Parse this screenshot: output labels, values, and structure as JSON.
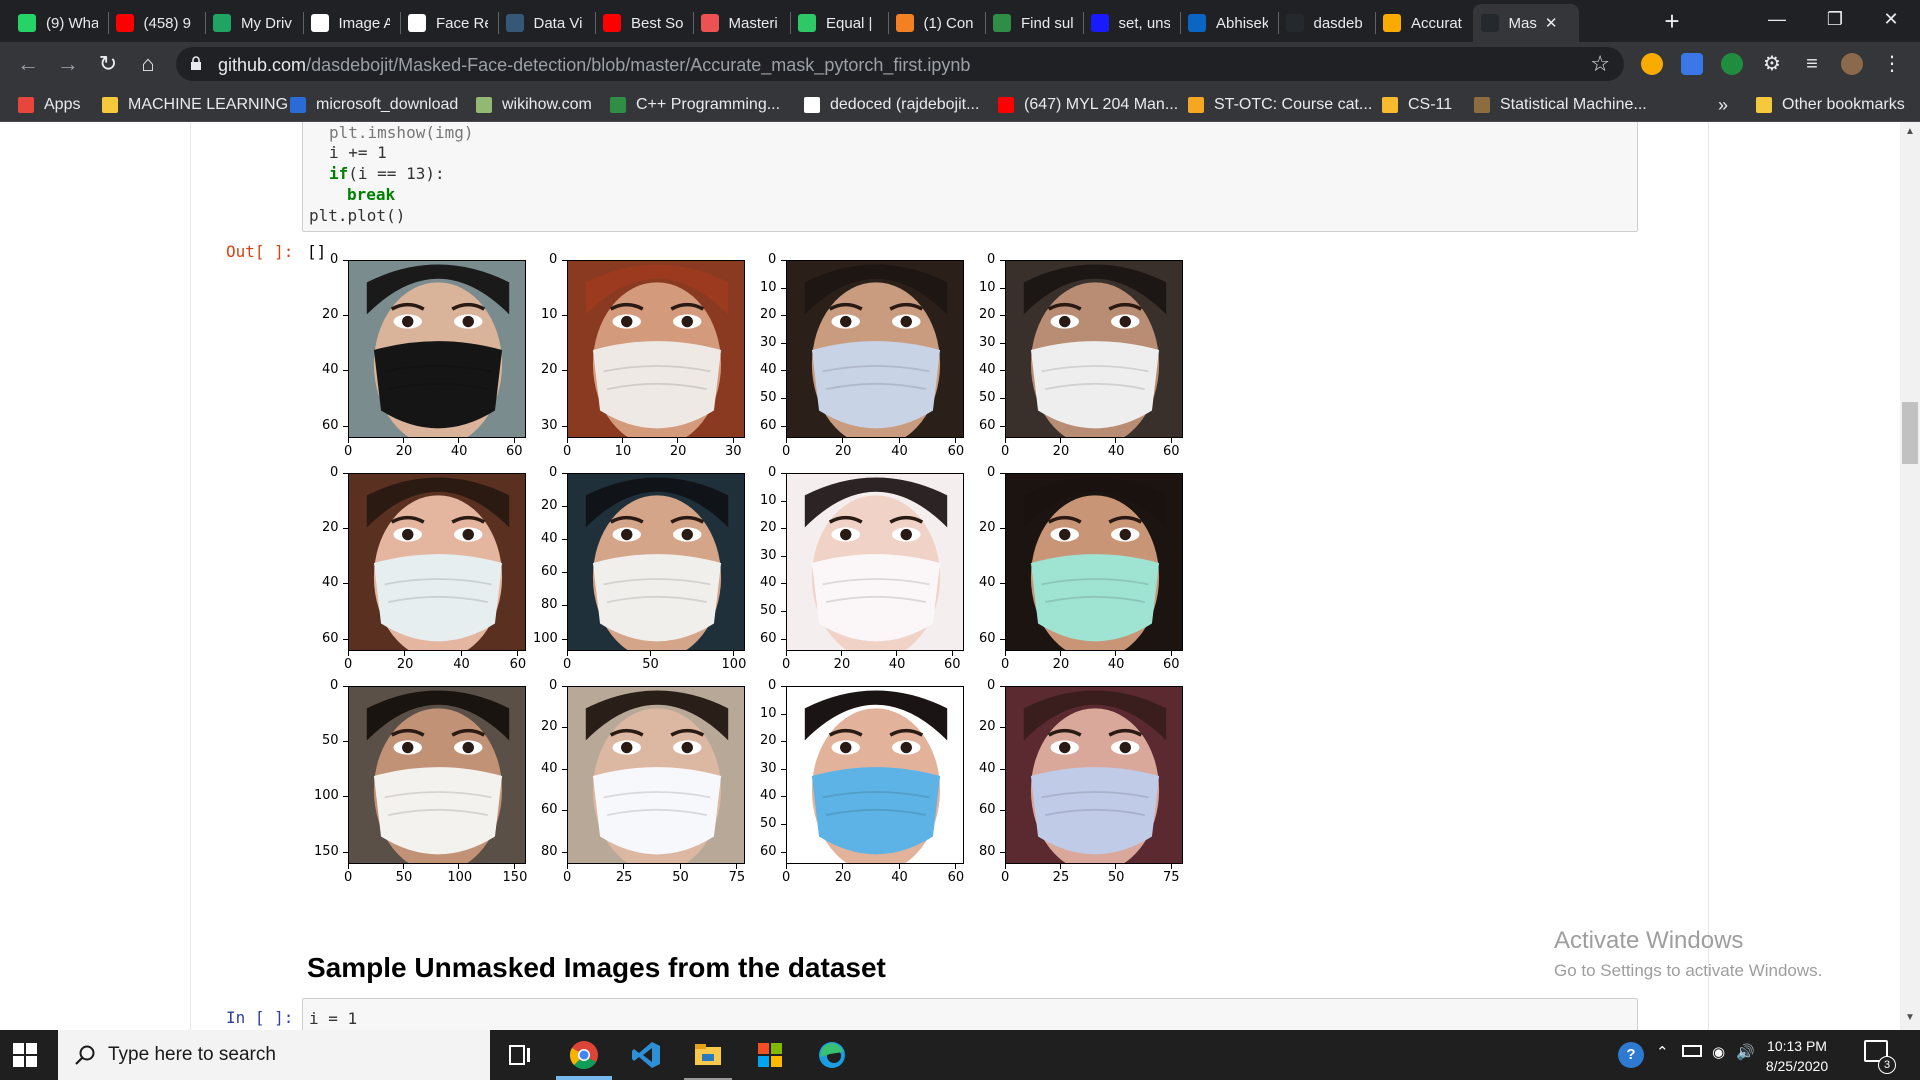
{
  "browser": {
    "tabs": [
      {
        "label": "(9) Wha",
        "icon": "whatsapp-icon",
        "color": "#25d366"
      },
      {
        "label": "(458) 9",
        "icon": "youtube-icon",
        "color": "#ff0000"
      },
      {
        "label": "My Driv",
        "icon": "google-drive-icon",
        "color": "#1fa463"
      },
      {
        "label": "Image A",
        "icon": "image-doc-icon",
        "color": "#ffffff"
      },
      {
        "label": "Face Re",
        "icon": "web-icon",
        "color": "#ffffff"
      },
      {
        "label": "Data Vi",
        "icon": "tds-icon",
        "color": "#355876"
      },
      {
        "label": "Best So",
        "icon": "youtube-icon",
        "color": "#ff0000"
      },
      {
        "label": "Masteri",
        "icon": "udemy-icon",
        "color": "#ec5252"
      },
      {
        "label": "Equal | I",
        "icon": "hackerrank-icon",
        "color": "#2ec866"
      },
      {
        "label": "(1) Con",
        "icon": "stackoverflow-icon",
        "color": "#f48024"
      },
      {
        "label": "Find sul",
        "icon": "gfg-icon",
        "color": "#2f8d46"
      },
      {
        "label": "set, uns",
        "icon": "dot-icon",
        "color": "#1a1aff"
      },
      {
        "label": "Abhisek",
        "icon": "linkedin-icon",
        "color": "#0a66c2"
      },
      {
        "label": "dasdeb",
        "icon": "github-icon",
        "color": "#24292e"
      },
      {
        "label": "Accurat",
        "icon": "colab-icon",
        "color": "#f9ab00"
      },
      {
        "label": "Mas",
        "icon": "github-icon",
        "color": "#24292e"
      }
    ],
    "url_host": "github.com",
    "url_path": "/dasdebojit/Masked-Face-detection/blob/master/Accurate_mask_pytorch_first.ipynb",
    "bookmarks": [
      {
        "label": "Apps",
        "icon": "apps-grid-icon",
        "color": "#e8453c"
      },
      {
        "label": "MACHINE LEARNING",
        "icon": "folder-icon",
        "color": "#f6c83b"
      },
      {
        "label": "microsoft_download",
        "icon": "microsoft-icon",
        "color": "#2b6bd6"
      },
      {
        "label": "wikihow.com",
        "icon": "wikihow-icon",
        "color": "#93b874"
      },
      {
        "label": "C++ Programming...",
        "icon": "gfg-icon",
        "color": "#2f8d46"
      },
      {
        "label": "dedoced (rajdebojit...",
        "icon": "web-icon",
        "color": "#ffffff"
      },
      {
        "label": "(647) MYL 204 Man...",
        "icon": "youtube-icon",
        "color": "#ff0000"
      },
      {
        "label": "ST-OTC: Course cat...",
        "icon": "iitm-icon",
        "color": "#f5a623"
      },
      {
        "label": "CS-11",
        "icon": "classroom-icon",
        "color": "#f9bb2d"
      },
      {
        "label": "Statistical Machine...",
        "icon": "stat-icon",
        "color": "#8c6d3f"
      }
    ],
    "more_bookmarks": "»",
    "other_bookmarks": "Other bookmarks"
  },
  "notebook": {
    "code_lines_top": [
      "plt.imshow(img)",
      "i += 1",
      "if(i == 13):",
      "break",
      "plt.plot()"
    ],
    "out_prompt": "Out[ ]:",
    "out_value": "[]",
    "section_heading": "Sample Unmasked Images from the dataset",
    "in_prompt": "In [ ]:",
    "next_code": "i = 1",
    "figure_panels": [
      {
        "xticks": [
          "0",
          "20",
          "40",
          "60"
        ],
        "yticks": [
          "0",
          "20",
          "40",
          "60"
        ],
        "bg": "#7a8c8e",
        "mask": "#151515",
        "skin": "#d9b49a",
        "hair": "#1a1a1a"
      },
      {
        "xticks": [
          "0",
          "10",
          "20",
          "30"
        ],
        "yticks": [
          "0",
          "10",
          "20",
          "30"
        ],
        "bg": "#8a3a20",
        "mask": "#efe9e5",
        "skin": "#d49a7c",
        "hair": "#9b3a1e"
      },
      {
        "xticks": [
          "0",
          "20",
          "40",
          "60"
        ],
        "yticks": [
          "0",
          "10",
          "20",
          "30",
          "40",
          "50",
          "60"
        ],
        "bg": "#2b1f1a",
        "mask": "#c9d3e6",
        "skin": "#c99c80",
        "hair": "#1e1612"
      },
      {
        "xticks": [
          "0",
          "20",
          "40",
          "60"
        ],
        "yticks": [
          "0",
          "10",
          "20",
          "30",
          "40",
          "50",
          "60"
        ],
        "bg": "#3a302b",
        "mask": "#eeeeee",
        "skin": "#b98d74",
        "hair": "#1c1714"
      },
      {
        "xticks": [
          "0",
          "20",
          "40",
          "60"
        ],
        "yticks": [
          "0",
          "20",
          "40",
          "60"
        ],
        "bg": "#5a3120",
        "mask": "#e6eef0",
        "skin": "#e4b6a0",
        "hair": "#2a1a12"
      },
      {
        "xticks": [
          "0",
          "50",
          "100"
        ],
        "yticks": [
          "0",
          "20",
          "40",
          "60",
          "80",
          "100"
        ],
        "bg": "#20303a",
        "mask": "#f1efec",
        "skin": "#d4a589",
        "hair": "#101418"
      },
      {
        "xticks": [
          "0",
          "20",
          "40",
          "60"
        ],
        "yticks": [
          "0",
          "10",
          "20",
          "30",
          "40",
          "50",
          "60"
        ],
        "bg": "#f4eeee",
        "mask": "#fbf6f8",
        "skin": "#f0d2c6",
        "hair": "#2c2424"
      },
      {
        "xticks": [
          "0",
          "20",
          "40",
          "60"
        ],
        "yticks": [
          "0",
          "20",
          "40",
          "60"
        ],
        "bg": "#1c1410",
        "mask": "#9fe3d2",
        "skin": "#c99577",
        "hair": "#1a120e"
      },
      {
        "xticks": [
          "0",
          "50",
          "100",
          "150"
        ],
        "yticks": [
          "0",
          "50",
          "100",
          "150"
        ],
        "bg": "#5a5048",
        "mask": "#f4f2ee",
        "skin": "#c29277",
        "hair": "#1a1410"
      },
      {
        "xticks": [
          "0",
          "25",
          "50",
          "75"
        ],
        "yticks": [
          "0",
          "20",
          "40",
          "60",
          "80"
        ],
        "bg": "#b8a898",
        "mask": "#f7f8fb",
        "skin": "#dcb8a2",
        "hair": "#2a1e18"
      },
      {
        "xticks": [
          "0",
          "20",
          "40",
          "60"
        ],
        "yticks": [
          "0",
          "10",
          "20",
          "30",
          "40",
          "50",
          "60"
        ],
        "bg": "#ffffff",
        "mask": "#5eb3e6",
        "skin": "#e2b39a",
        "hair": "#1a1414"
      },
      {
        "xticks": [
          "0",
          "25",
          "50",
          "75"
        ],
        "yticks": [
          "0",
          "20",
          "40",
          "60",
          "80"
        ],
        "bg": "#5a2a30",
        "mask": "#c0cbe8",
        "skin": "#d9a89a",
        "hair": "#3a1e1e"
      }
    ]
  },
  "watermark": {
    "line1": "Activate Windows",
    "line2": "Go to Settings to activate Windows."
  },
  "taskbar": {
    "search_placeholder": "Type here to search",
    "time": "10:13 PM",
    "date": "8/25/2020",
    "notification_count": "3"
  }
}
